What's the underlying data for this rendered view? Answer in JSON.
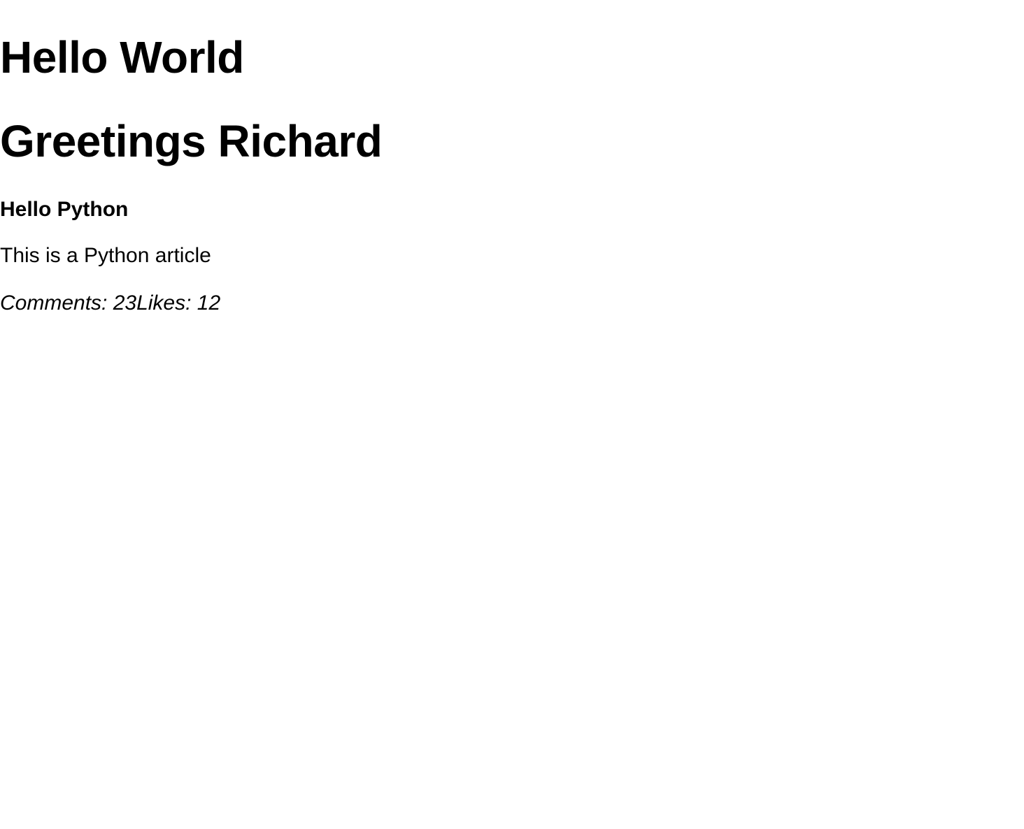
{
  "page": {
    "heading_1": "Hello World",
    "heading_2": "Greetings Richard"
  },
  "article": {
    "title": "Hello Python",
    "body": "This is a Python article",
    "comments_text": "Comments: 23",
    "likes_text": "Likes: 12"
  }
}
